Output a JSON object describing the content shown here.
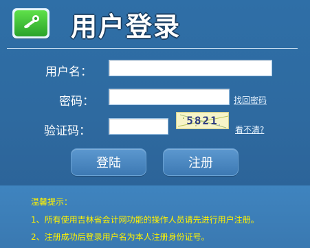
{
  "header": {
    "title": "用户登录",
    "icon": "key-icon",
    "accent": "#2aa32a"
  },
  "form": {
    "username_label": "用户名：",
    "password_label": "密码：",
    "captcha_label": "验证码：",
    "username_value": "",
    "password_value": "",
    "captcha_value": "",
    "forgot_password_link": "找回密码",
    "captcha_image_text": "5821",
    "refresh_captcha_link": "看不清?"
  },
  "buttons": {
    "login": "登陆",
    "register": "注册"
  },
  "notes": {
    "title": "温馨提示：",
    "lines": [
      "1、所有使用吉林省会计网功能的操作人员请先进行用户注册。",
      "2、注册成功后登录用户名为本人注册身份证号。"
    ],
    "text_color": "#fff200"
  }
}
